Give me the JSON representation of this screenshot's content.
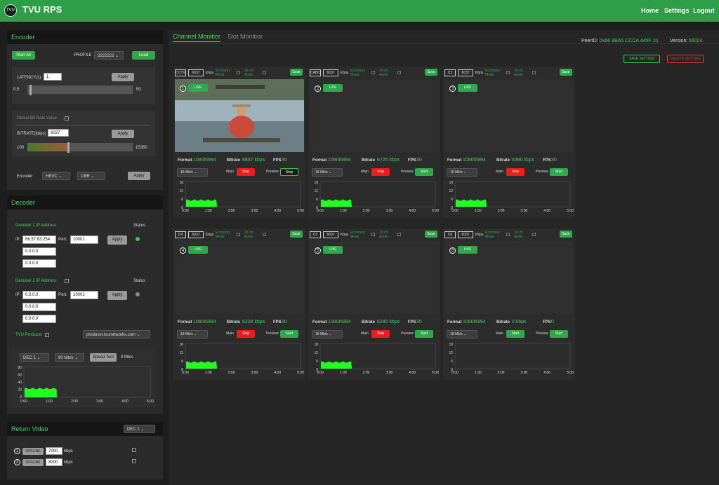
{
  "app": {
    "title": "TVU RPS",
    "logo_text": "TVU"
  },
  "nav": {
    "home": "Home",
    "settings": "Settings",
    "logout": "Logout"
  },
  "encoder": {
    "heading": "Encoder",
    "start_all": "Start All",
    "profile_label": "PROFILE",
    "profile_value": "2222222",
    "load": "Load",
    "latency_label": "LATENCY(s)",
    "latency_value": "1",
    "apply": "Apply",
    "latency_min": "0.5",
    "latency_max": "50",
    "latency_fraction": 0.02,
    "global_bitrate_label": "Global Bit Rate Value",
    "bitrate_label": "BITRATE(kbps)",
    "bitrate_value": "6037",
    "bitrate_min": "100",
    "bitrate_max": "15360",
    "bitrate_fraction": 0.39,
    "encoder_label": "Encoder",
    "codec": "HEVC",
    "rate_mode": "CBR"
  },
  "decoder": {
    "heading": "Decoder",
    "status_label": "Status",
    "d1_label": "Decoder 1 IP Address:",
    "d2_label": "Decoder 2 IP Address:",
    "ip_label": "IP:",
    "port_label": "Port:",
    "apply": "Apply",
    "d1_ip": "66.57.63.254",
    "d1_port": "10001",
    "d1_extra1": "0.0.0.0",
    "d1_extra2": "0.0.0.0",
    "d2_ip": "0.0.0.0",
    "d2_port": "10001",
    "d2_extra1": "0.0.0.0",
    "d2_extra2": "0.0.0.0",
    "producer_label": "TVU Producer",
    "producer_value": "producer.tvunetworks.com",
    "dec_select": "DEC 1",
    "rate_select": "80 Mb/s",
    "speed_test": "Speed Test",
    "speed_value": "0 Mb/s",
    "chart_y_ticks": [
      "80",
      "60",
      "40",
      "20",
      "0"
    ],
    "chart_x_ticks": [
      "0:00",
      "1:00",
      "2:00",
      "3:00",
      "4:00",
      "5:00"
    ],
    "colors": {
      "status_on": "#2fd04a",
      "status_off": "#8a8a8a"
    }
  },
  "return_video": {
    "heading": "Return Video",
    "dec_select": "DEC 1",
    "rows": [
      {
        "num": "1",
        "state": "OFFLINE",
        "value": "7000",
        "unit": "kbps"
      },
      {
        "num": "2",
        "state": "OFFLINE",
        "value": "8000",
        "unit": "kbps"
      }
    ]
  },
  "main": {
    "tab_channel": "Channel Monitior",
    "tab_slot": "Slot Monitior",
    "peer_label": "PeerID:",
    "peer_value": "0x66 8BA5 CCCA 445F 10",
    "version_label": "Version:",
    "version_value": "65024",
    "save_setting": "SAVE SETTING",
    "delete_setting": "DELETE SETTING"
  },
  "channel_labels": {
    "kbps": "Kbps",
    "economy": "Economy Mode",
    "audio": "16 ch. Audio",
    "save": "Save",
    "live": "LIVE",
    "format": "Format",
    "bitrate": "Bitrate",
    "fps": "FPS",
    "main": "Main",
    "preview": "Preview",
    "rate": "18 Mb/s",
    "y_ticks": [
      "18",
      "12",
      "6",
      "0"
    ],
    "x_ticks": [
      "0:00",
      "1:00",
      "2:00",
      "3:00",
      "4:00",
      "5:00"
    ]
  },
  "channels": [
    {
      "name": "CCTV",
      "kbps": "6037",
      "num": "1",
      "format": "1080i5994",
      "bitrate": "6847 kbps",
      "fps": "30",
      "main_btn": "Stop",
      "preview_btn": "Stop",
      "main_on": true,
      "preview_on": true,
      "has_video": true,
      "level": 0.3
    },
    {
      "name": "CABC",
      "kbps": "6037",
      "num": "2",
      "format": "1080i5994",
      "bitrate": "6725 kbps",
      "fps": "30",
      "main_btn": "Stop",
      "preview_btn": "Start",
      "main_on": true,
      "preview_on": false,
      "has_video": false,
      "level": 0.3
    },
    {
      "name": "C3",
      "kbps": "6037",
      "num": "3",
      "format": "1080i5994",
      "bitrate": "6390 kbps",
      "fps": "30",
      "main_btn": "Stop",
      "preview_btn": "Start",
      "main_on": true,
      "preview_on": false,
      "has_video": false,
      "level": 0.3
    },
    {
      "name": "C4",
      "kbps": "6037",
      "num": "4",
      "format": "1080i5994",
      "bitrate": "6238 kbps",
      "fps": "30",
      "main_btn": "Stop",
      "preview_btn": "Start",
      "main_on": true,
      "preview_on": false,
      "has_video": false,
      "level": 0.3
    },
    {
      "name": "C5",
      "kbps": "6037",
      "num": "5",
      "format": "1080i5994",
      "bitrate": "6280 kbps",
      "fps": "30",
      "main_btn": "Stop",
      "preview_btn": "Start",
      "main_on": true,
      "preview_on": false,
      "has_video": false,
      "level": 0.3
    },
    {
      "name": "C6",
      "kbps": "6037",
      "num": "6",
      "format": "1080i5994",
      "bitrate": "0 kbps",
      "fps": "0",
      "main_btn": "Start",
      "preview_btn": "Start",
      "main_on": false,
      "preview_on": false,
      "has_video": false,
      "level": 0
    }
  ],
  "colors": {
    "accent": "#2fa94b",
    "stop": "#ee1c1c",
    "chart_fill": "#22ff22",
    "text_green": "#42d15a"
  }
}
